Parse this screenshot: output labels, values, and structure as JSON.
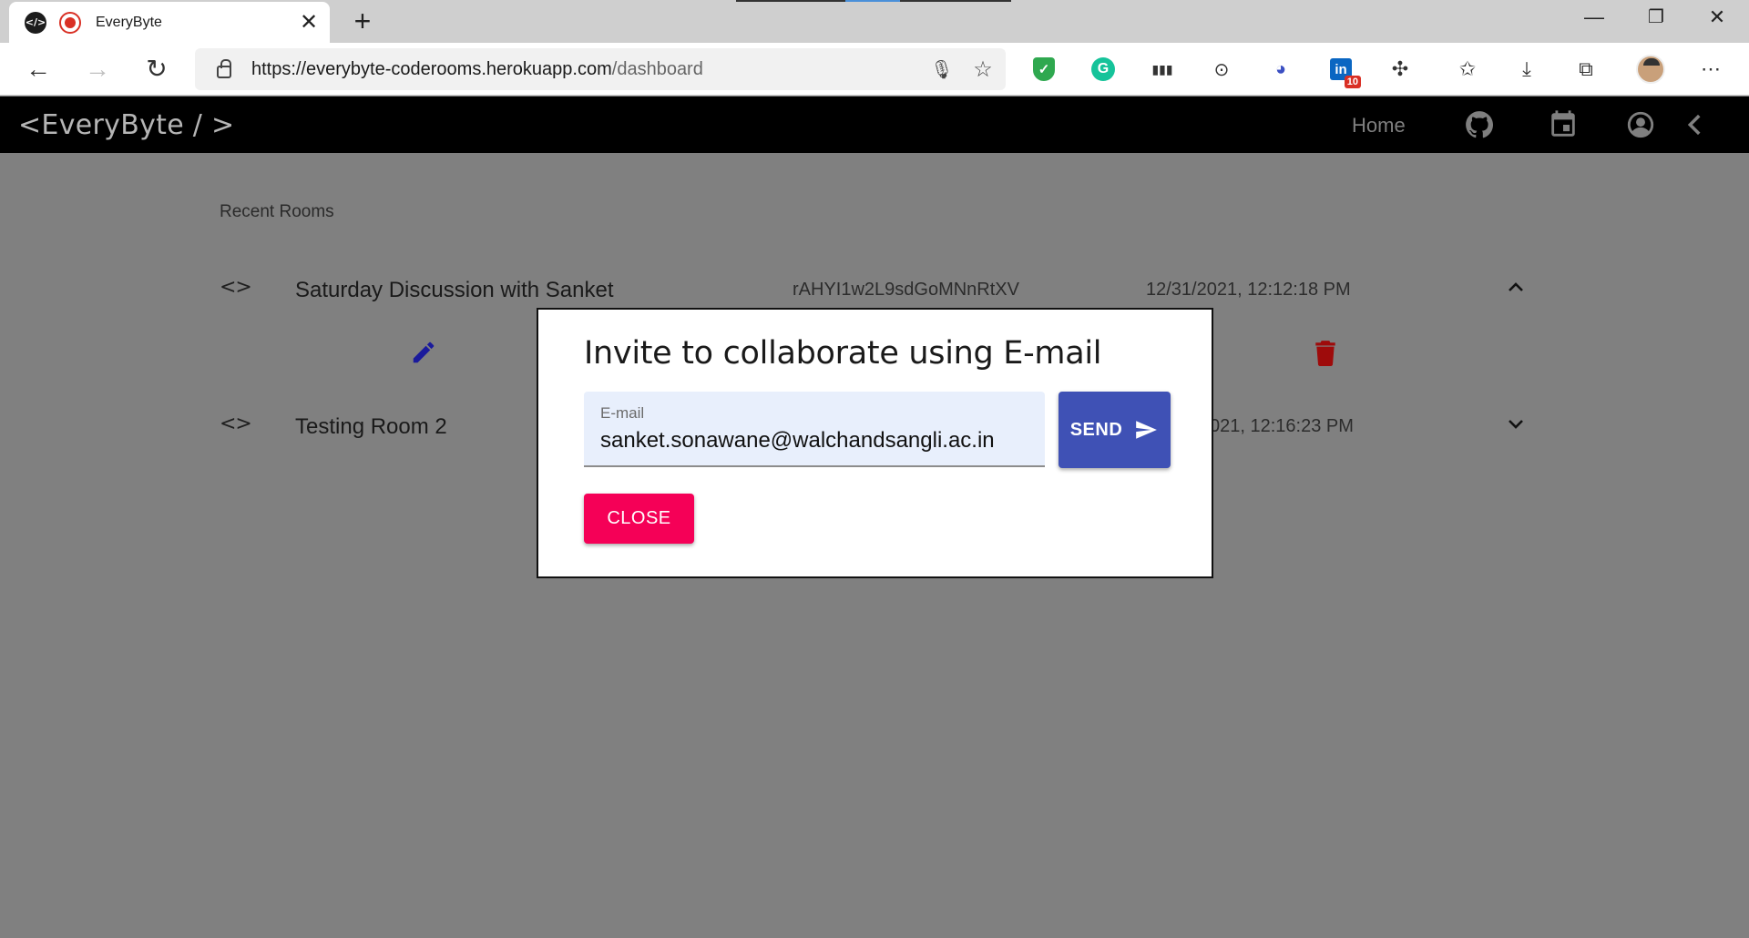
{
  "browser": {
    "tab_title": "EveryByte",
    "tab_favicon_text": "</>",
    "url_main": "https://everybyte-coderooms.herokuapp.com",
    "url_path": "/dashboard",
    "linkedin_badge": "10",
    "linkedin_text": "in",
    "grammarly_text": "G",
    "icons": [
      "back-icon",
      "forward-icon",
      "reload-icon",
      "lock-icon",
      "mic-icon",
      "favorite-add-icon",
      "shield-extension-icon",
      "grammarly-icon",
      "meter-extension-icon",
      "code-extension-icon",
      "circle-extension-icon",
      "linkedin-icon",
      "puzzle-icon",
      "favorites-icon",
      "download-icon",
      "collections-icon",
      "profile-avatar",
      "more-icon"
    ]
  },
  "appbar": {
    "brand": "<EveryByte / >",
    "home": "Home"
  },
  "recent": {
    "title": "Recent Rooms",
    "rooms": [
      {
        "name": "Saturday Discussion with Sanket",
        "room_id": "rAHYI1w2L9sdGoMNnRtXV",
        "date": "12/31/2021, 12:12:18 PM",
        "expanded": true
      },
      {
        "name": "Testing Room 2",
        "room_id": "",
        "date": "021, 12:16:23 PM",
        "expanded": false
      }
    ],
    "code_glyph": "<>"
  },
  "dialog": {
    "title": "Invite to collaborate using E-mail",
    "email_label": "E-mail",
    "email_value": "sanket.sonawane@walchandsangli.ac.in",
    "send_label": "SEND",
    "close_label": "CLOSE"
  },
  "colors": {
    "overlay": "#808080",
    "send": "#3f51b5",
    "close": "#f50057",
    "edit_icon": "#1a1a9c",
    "delete_icon": "#9e0b0b"
  }
}
